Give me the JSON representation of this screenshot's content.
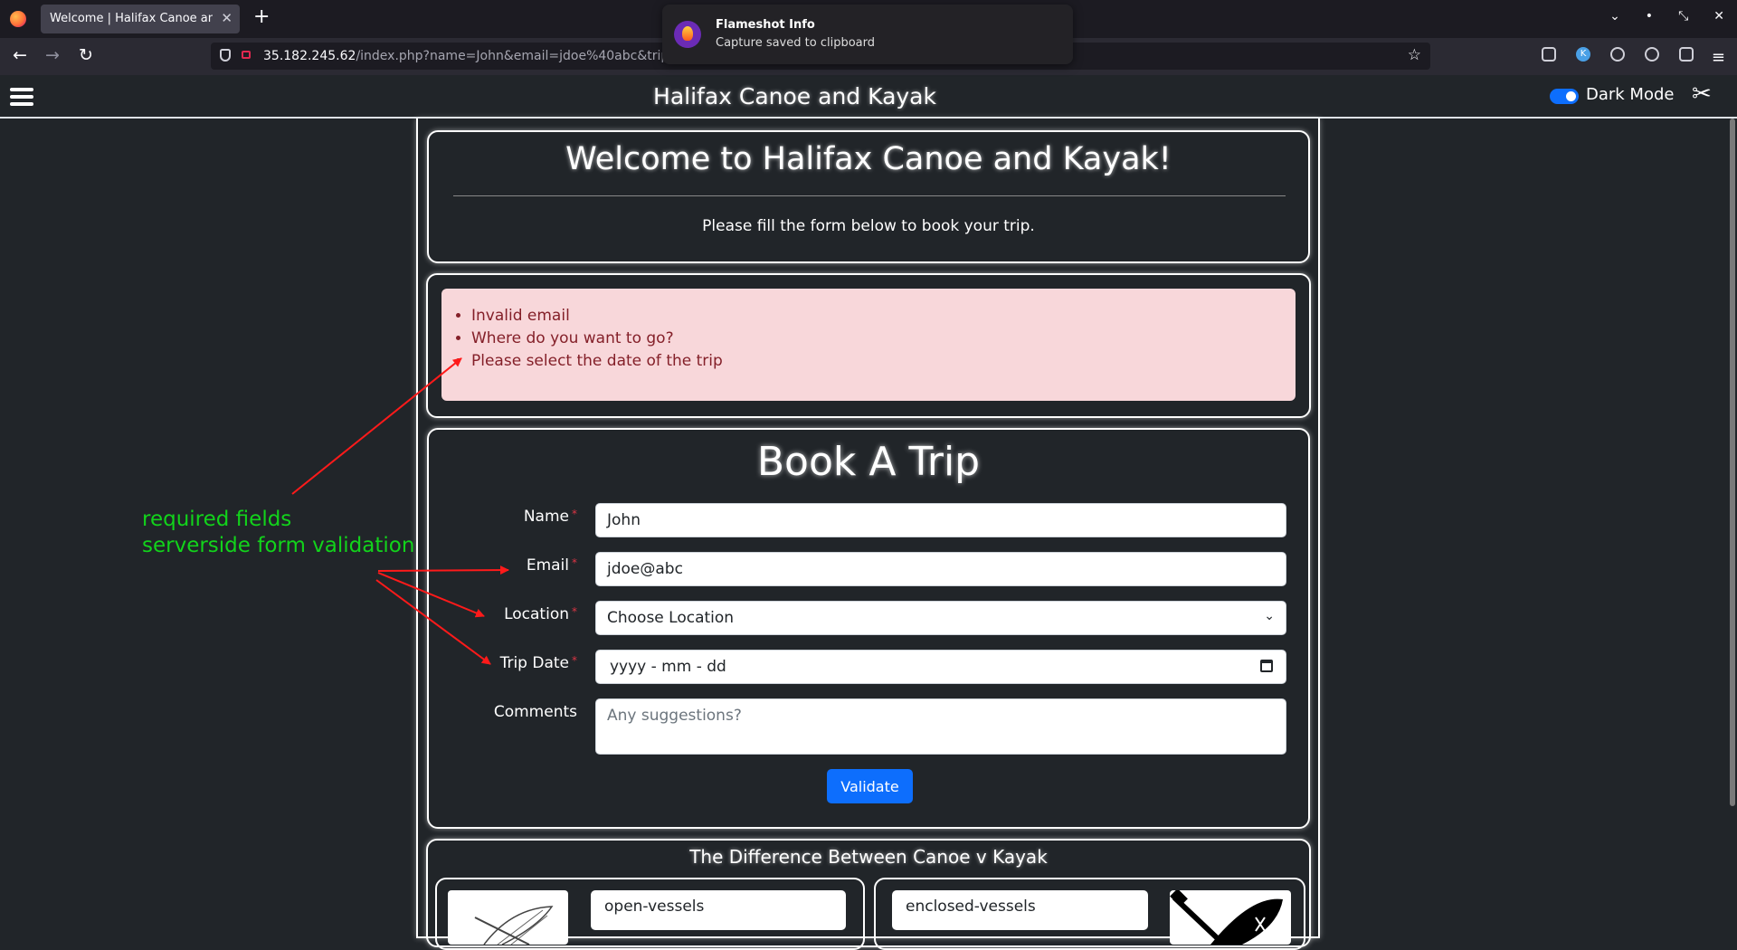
{
  "browser": {
    "tab_title": "Welcome | Halifax Canoe and Kayak",
    "new_tab": "+",
    "url_host": "35.182.245.62",
    "url_path": "/index.php?name=John&email=jdoe%40abc&trip-da"
  },
  "toast": {
    "title": "Flameshot Info",
    "body": "Capture saved to clipboard"
  },
  "header": {
    "title": "Halifax Canoe and Kayak",
    "dark_mode_label": "Dark Mode",
    "dark_mode_on": true
  },
  "welcome": {
    "heading": "Welcome to Halifax Canoe and Kayak!",
    "subtext": "Please fill the form below to book your trip."
  },
  "errors": [
    "Invalid email",
    "Where do you want to go?",
    "Please select the date of the trip"
  ],
  "form": {
    "heading": "Book A Trip",
    "name_label": "Name",
    "name_value": "John",
    "email_label": "Email",
    "email_value": "jdoe@abc",
    "location_label": "Location",
    "location_value": "Choose Location",
    "date_label": "Trip Date",
    "date_placeholder": "yyyy - mm - dd",
    "comments_label": "Comments",
    "comments_placeholder": "Any suggestions?",
    "required_mark": "*",
    "validate_label": "Validate"
  },
  "difference": {
    "heading": "The Difference Between Canoe v Kayak",
    "left_item": "open-vessels",
    "right_item": "enclosed-vessels"
  },
  "annotation": {
    "line1": "required fields",
    "line2": "serverside form validation",
    "color": "#12d31b",
    "arrow_color": "#ff1a1a"
  }
}
